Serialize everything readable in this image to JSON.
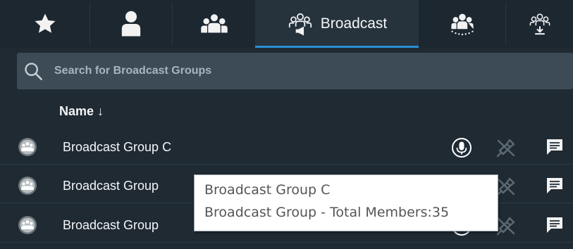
{
  "tabs": [
    {
      "icon": "star-icon",
      "label": ""
    },
    {
      "icon": "person-icon",
      "label": ""
    },
    {
      "icon": "group-icon",
      "label": ""
    },
    {
      "icon": "broadcast-group-icon",
      "label": "Broadcast",
      "active": true
    },
    {
      "icon": "conference-group-icon",
      "label": ""
    },
    {
      "icon": "group-download-icon",
      "label": ""
    }
  ],
  "search": {
    "placeholder": "Search for Broadcast Groups"
  },
  "list": {
    "header": "Name ↓",
    "rows": [
      {
        "name": "Broadcast Group C"
      },
      {
        "name": "Broadcast Group"
      },
      {
        "name": "Broadcast Group"
      }
    ]
  },
  "tooltip": {
    "title": "Broadcast Group C",
    "detail": "Broadcast Group - Total Members:35"
  },
  "colors": {
    "accent": "#2b8fd4",
    "background": "#1f2a33",
    "search_bg": "#3d4b56"
  }
}
